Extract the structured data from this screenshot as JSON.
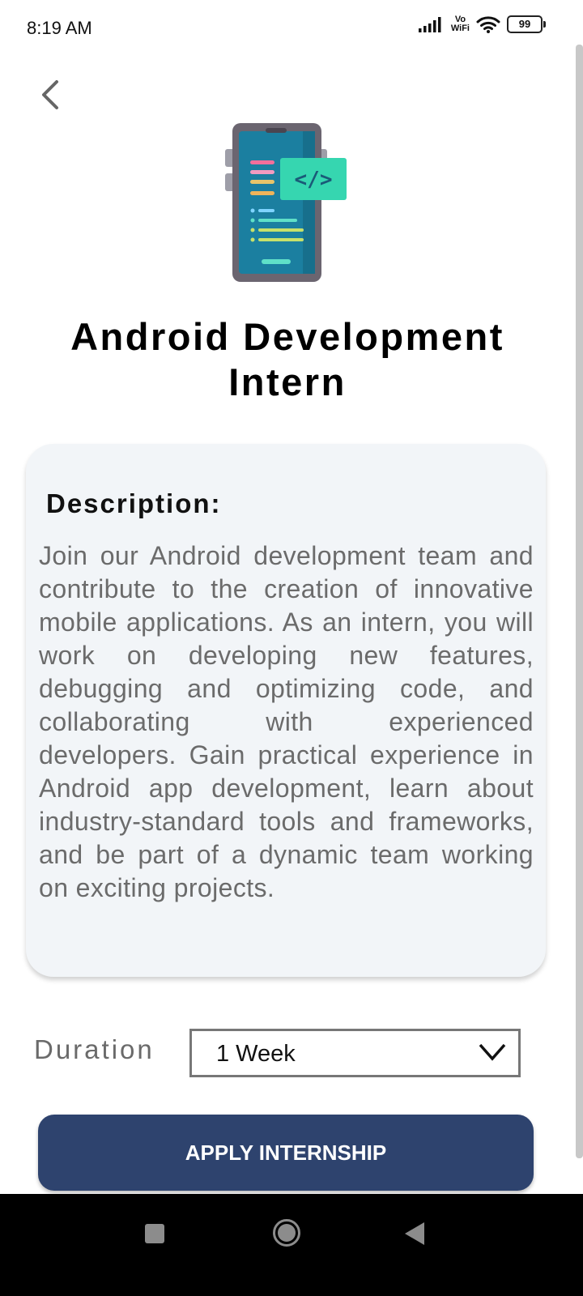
{
  "status_bar": {
    "time": "8:19 AM",
    "vowifi_top": "Vo",
    "vowifi_bottom": "WiFi",
    "battery": "99",
    "icons": [
      "signal-icon",
      "vowifi-icon",
      "wifi-icon",
      "battery-icon"
    ]
  },
  "header": {
    "back_icon": "back-arrow-icon",
    "illustration_icon": "phone-code-icon",
    "illustration_code_glyph": "</>",
    "title": "Android Development Intern"
  },
  "description": {
    "heading": "Description:",
    "body": "Join our Android development team and contribute to the creation of innovative mobile applications. As an intern, you will work on developing new features, debugging and optimizing code, and collaborating with experienced developers. Gain practical experience in Android app development, learn about industry-standard tools and frameworks, and be part of a dynamic team working on exciting projects."
  },
  "duration": {
    "label": "Duration",
    "selected": "1 Week",
    "chevron_icon": "chevron-down-icon"
  },
  "apply_button": {
    "label": "APPLY INTERNSHIP"
  },
  "nav_bar": {
    "recents_icon": "square-recents-icon",
    "home_icon": "circle-home-icon",
    "back_icon": "triangle-back-icon"
  },
  "colors": {
    "primary_button": "#2e436e",
    "card_background": "#f2f5f8",
    "body_text": "#6b6b6b"
  }
}
